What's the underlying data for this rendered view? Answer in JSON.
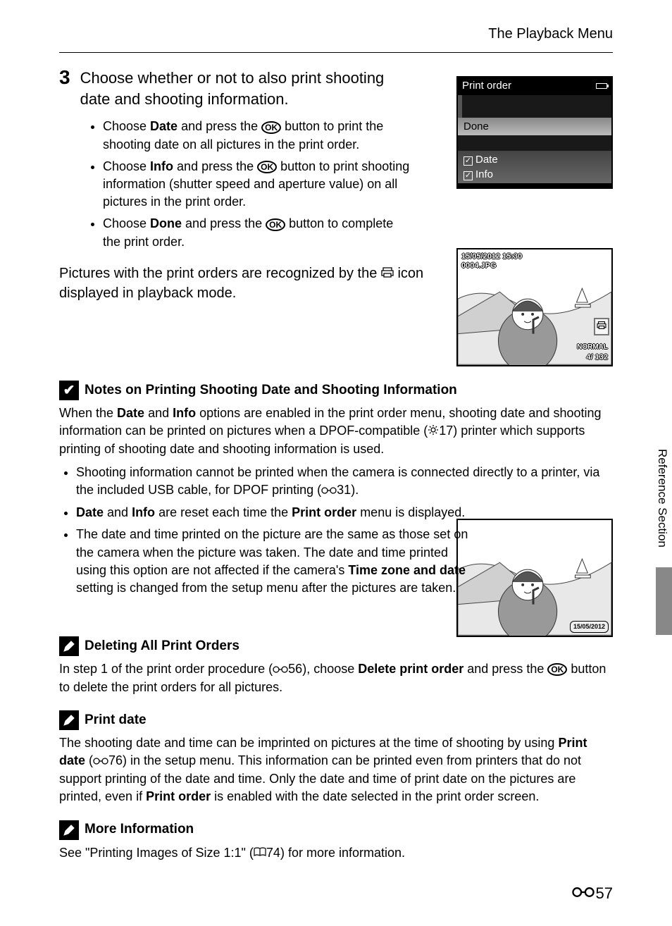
{
  "header": {
    "title": "The Playback Menu"
  },
  "step": {
    "num": "3",
    "heading_line1": "Choose whether or not to also print shooting",
    "heading_line2": "date and shooting information.",
    "b1_pre": "Choose ",
    "b1_bold": "Date",
    "b1_mid": " and press the ",
    "b1_post": " button to print the shooting date on all pictures in the print order.",
    "b2_pre": "Choose ",
    "b2_bold": "Info",
    "b2_mid": " and press the ",
    "b2_post": " button to print shooting information (shutter speed and aperture value) on all pictures in the print order.",
    "b3_pre": "Choose ",
    "b3_bold": "Done",
    "b3_mid": " and press the ",
    "b3_post": " button to complete the print order."
  },
  "para1_pre": "Pictures with the print orders are recognized by the ",
  "para1_post": " icon displayed in playback mode.",
  "camera1": {
    "title": "Print order",
    "done": "Done",
    "opt1": "Date",
    "opt2": "Info"
  },
  "camera2": {
    "date": "15/05/2012 15:30",
    "file": "0004.JPG",
    "quality": "NORMAL",
    "count": "4/ 132",
    "datest": "15/05/2012"
  },
  "notes": {
    "title": "Notes on Printing Shooting Date and Shooting Information",
    "p_a": "When the ",
    "p_b": "Date",
    "p_c": " and ",
    "p_d": "Info",
    "p_e": " options are enabled in the print order menu, shooting date and shooting information can be printed on pictures when a DPOF-compatible (",
    "p_f": "17) printer which supports printing of shooting date and shooting information is used.",
    "b1": "Shooting information cannot be printed when the camera is connected directly to a printer, via the included USB cable, for DPOF printing (",
    "b1_post": "31).",
    "b2_a": "Date",
    "b2_b": " and ",
    "b2_c": "Info",
    "b2_d": " are reset each time the ",
    "b2_e": "Print order",
    "b2_f": " menu is displayed.",
    "b3_a": "The date and time printed on the picture are the same as those set on the camera when the picture was taken. The date and time printed using this option are not affected if the camera's ",
    "b3_b": "Time zone and date",
    "b3_c": " setting is changed from the setup menu after the pictures are taken."
  },
  "del": {
    "title": "Deleting All Print Orders",
    "p_a": "In step 1 of the print order procedure (",
    "p_b": "56), choose ",
    "p_c": "Delete print order",
    "p_d": " and press the ",
    "p_e": " button to delete the print orders for all pictures."
  },
  "pd": {
    "title": "Print date",
    "p_a": "The shooting date and time can be imprinted on pictures at the time of shooting by using ",
    "p_b": "Print date",
    "p_c": " (",
    "p_d": "76) in the setup menu. This information can be printed even from printers that do not support printing of the date and time. Only the date and time of print date on the pictures are printed, even if ",
    "p_e": "Print order",
    "p_f": " is enabled with the date selected in the print order screen."
  },
  "more": {
    "title": "More Information",
    "p_a": "See \"Printing Images of Size 1:1\" (",
    "p_b": "74) for more information."
  },
  "side": "Reference Section",
  "page": "57"
}
